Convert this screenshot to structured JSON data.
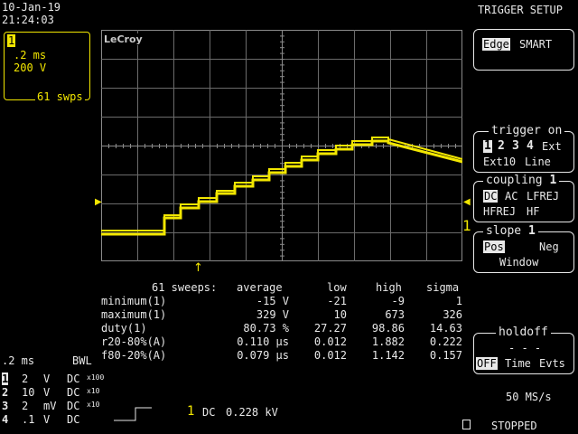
{
  "header": {
    "date": "10-Jan-19",
    "time": "21:24:03",
    "menu_title": "TRIGGER SETUP"
  },
  "channel_box": {
    "channel": "1",
    "timebase": ".2 ms",
    "volts": "200 V",
    "sweeps": "61 swps"
  },
  "brand": "LeCroy",
  "colors": {
    "trace": "#f2e600",
    "grid": "#6b6b6b",
    "text": "#e8e8e8",
    "background": "#000000"
  },
  "trace_marker": "1",
  "measurements": {
    "sweeps_label": "61 sweeps:",
    "columns": [
      "average",
      "low",
      "high",
      "sigma"
    ],
    "rows": [
      {
        "name": "minimum(1)",
        "average": "-15 V",
        "low": "-21",
        "high": "-9",
        "sigma": "1"
      },
      {
        "name": "maximum(1)",
        "average": "329 V",
        "low": "10",
        "high": "673",
        "sigma": "326"
      },
      {
        "name": "duty(1)",
        "average": "80.73 %",
        "low": "27.27",
        "high": "98.86",
        "sigma": "14.63"
      },
      {
        "name": "r20-80%(A)",
        "average": "0.110 µs",
        "low": "0.012",
        "high": "1.882",
        "sigma": "0.222"
      },
      {
        "name": "f80-20%(A)",
        "average": "0.079 µs",
        "low": "0.012",
        "high": "1.142",
        "sigma": "0.157"
      }
    ]
  },
  "bottom": {
    "timebase": ".2 ms",
    "bwl": "BWL",
    "channels": [
      {
        "num": "1",
        "scale": "2",
        "unit": "V",
        "coupling": "DC",
        "probe": "x100"
      },
      {
        "num": "2",
        "scale": "10",
        "unit": "V",
        "coupling": "DC",
        "probe": "x10"
      },
      {
        "num": "3",
        "scale": "2",
        "unit": "mV",
        "coupling": "DC",
        "probe": "x10"
      },
      {
        "num": "4",
        "scale": ".1",
        "unit": "V",
        "coupling": "DC",
        "probe": ""
      }
    ],
    "trigger_channel": "1",
    "trigger_coupling": "DC",
    "trigger_level": "0.228 kV",
    "sample_rate": "50 MS/s",
    "status": "STOPPED"
  },
  "menu": {
    "edge": {
      "selected": "Edge",
      "other": "SMART"
    },
    "trigger_on": {
      "title": "trigger on",
      "sources": [
        "1",
        "2",
        "3",
        "4"
      ],
      "selected": "1",
      "ext": "Ext",
      "ext10": "Ext10",
      "line": "Line"
    },
    "coupling": {
      "title": "coupling",
      "channel": "1",
      "selected": "DC",
      "ac": "AC",
      "lfrej": "LFREJ",
      "hfrej": "HFREJ",
      "hf": "HF"
    },
    "slope": {
      "title": "slope",
      "channel": "1",
      "selected": "Pos",
      "neg": "Neg",
      "window": "Window"
    },
    "holdoff": {
      "title": "holdoff",
      "value": "- - -",
      "selected": "OFF",
      "time": "Time",
      "evts": "Evts"
    }
  }
}
